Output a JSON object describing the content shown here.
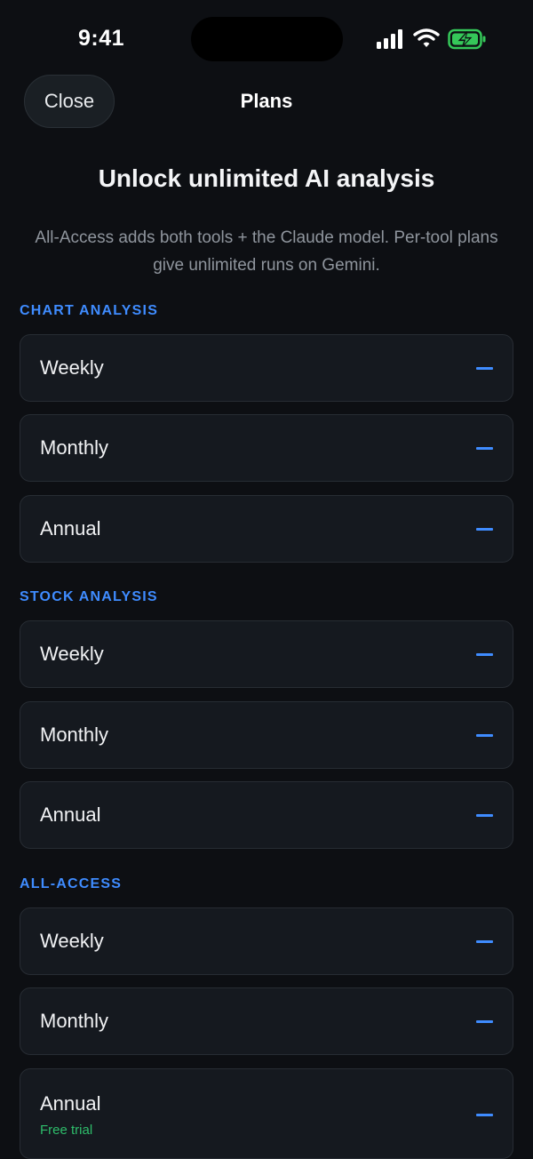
{
  "status_bar": {
    "time": "9:41",
    "icons": [
      "cellular-signal-icon",
      "wifi-icon",
      "battery-charging-icon"
    ],
    "battery_color": "#35c759"
  },
  "nav": {
    "close_label": "Close",
    "title": "Plans"
  },
  "hero": {
    "title": "Unlock unlimited AI analysis",
    "subtitle": "All-Access adds both tools + the Claude model. Per-tool plans give unlimited runs on Gemini."
  },
  "colors": {
    "background": "#0d0f13",
    "card": "#15191f",
    "accent": "#3f8cff",
    "trial": "#2ebd6b"
  },
  "sections": [
    {
      "label": "CHART ANALYSIS",
      "plans": [
        {
          "label": "Weekly",
          "price": "—"
        },
        {
          "label": "Monthly",
          "price": "—"
        },
        {
          "label": "Annual",
          "price": "—"
        }
      ]
    },
    {
      "label": "STOCK ANALYSIS",
      "plans": [
        {
          "label": "Weekly",
          "price": "—"
        },
        {
          "label": "Monthly",
          "price": "—"
        },
        {
          "label": "Annual",
          "price": "—"
        }
      ]
    },
    {
      "label": "ALL-ACCESS",
      "plans": [
        {
          "label": "Weekly",
          "price": "—"
        },
        {
          "label": "Monthly",
          "price": "—"
        },
        {
          "label": "Annual",
          "price": "—",
          "note": "Free trial"
        }
      ]
    }
  ]
}
